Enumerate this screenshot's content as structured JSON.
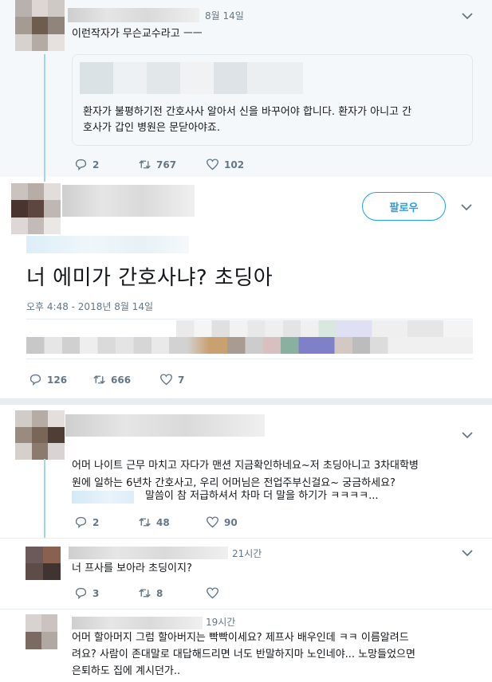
{
  "tweet1": {
    "time": "8월 14일",
    "text": "이런작자가 무슨교수라고 ㅡㅡ",
    "quote_text_line1": "환자가 불평하기전 간호사사 알아서 신을 바꾸어야 합니다. 환자가 아니고 간",
    "quote_text_line2": "호사가 갑인 병원은 문닫아야죠.",
    "replies": "2",
    "retweets": "767",
    "likes": "102"
  },
  "main_tweet": {
    "follow_label": "팔로우",
    "text": "너 에미가 간호사냐? 초딩아",
    "timestamp": "오후 4:48 - 2018년 8월 14일",
    "replies": "126",
    "retweets": "666",
    "likes": "7"
  },
  "reply1": {
    "line1": "어머 나이트 근무 마치고 자다가 맨션 지금확인하네요~저 초딩아니고 3차대학병",
    "line2": "원에 일하는 6년차 간호사고, 우리 어머님은 전업주부신걸요~ 궁금하세요?",
    "line3": "말씀이 참 저급하셔서 차마 더 말을 하기가 ㅋㅋㅋㅋ...",
    "replies": "2",
    "retweets": "48",
    "likes": "90"
  },
  "reply2": {
    "time": "21시간",
    "text": "너 프사를 보아라 초딩이지?",
    "replies": "3",
    "retweets": "8",
    "likes": ""
  },
  "reply3": {
    "time": "19시간",
    "line1": "어머 할아머지 그럼 할아버지는 빡빡이세요?  제프사 배우인데 ㅋㅋ 이름알려드",
    "line2": "려요? 사람이 존대말로 대답해드리면 너도 반말하지마 노인네야... 노망들었으면",
    "line3": "은퇴하도 집에 계시던가.."
  },
  "colors": {
    "accent": "#1da1f2",
    "muted": "#657786",
    "thread": "#a4d4f4"
  }
}
